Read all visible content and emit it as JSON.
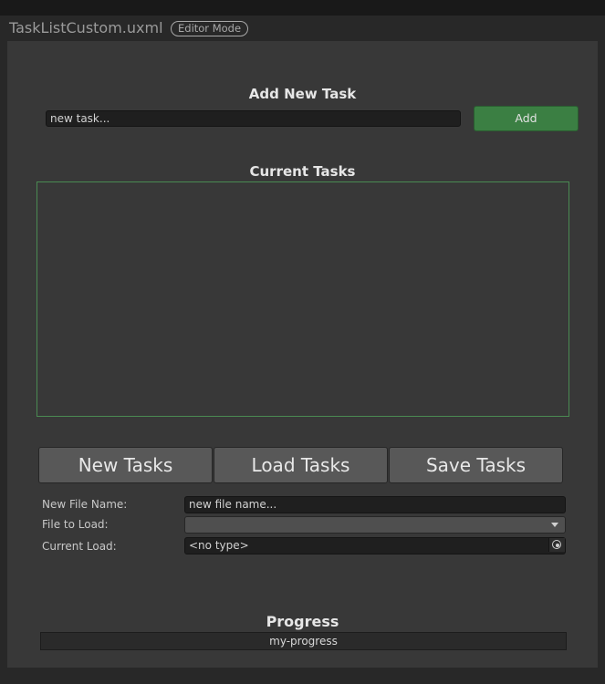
{
  "window": {
    "title": "TaskListCustom.uxml",
    "mode_badge": "Editor Mode"
  },
  "add_section": {
    "heading": "Add New Task",
    "task_input_value": "new task...",
    "add_label": "Add"
  },
  "tasks_section": {
    "heading": "Current Tasks",
    "items": []
  },
  "buttons": {
    "new": "New Tasks",
    "load": "Load Tasks",
    "save": "Save Tasks"
  },
  "fields": {
    "file_name_label": "New File Name:",
    "file_name_value": "new file name...",
    "file_to_load_label": "File to Load:",
    "file_to_load_value": "",
    "current_load_label": "Current Load:",
    "current_load_value": "<no type>"
  },
  "progress": {
    "heading": "Progress",
    "bar_text": "my-progress"
  },
  "colors": {
    "accent_green": "#3b7f43",
    "list_border": "#4a8a52",
    "panel_bg": "#383838"
  }
}
